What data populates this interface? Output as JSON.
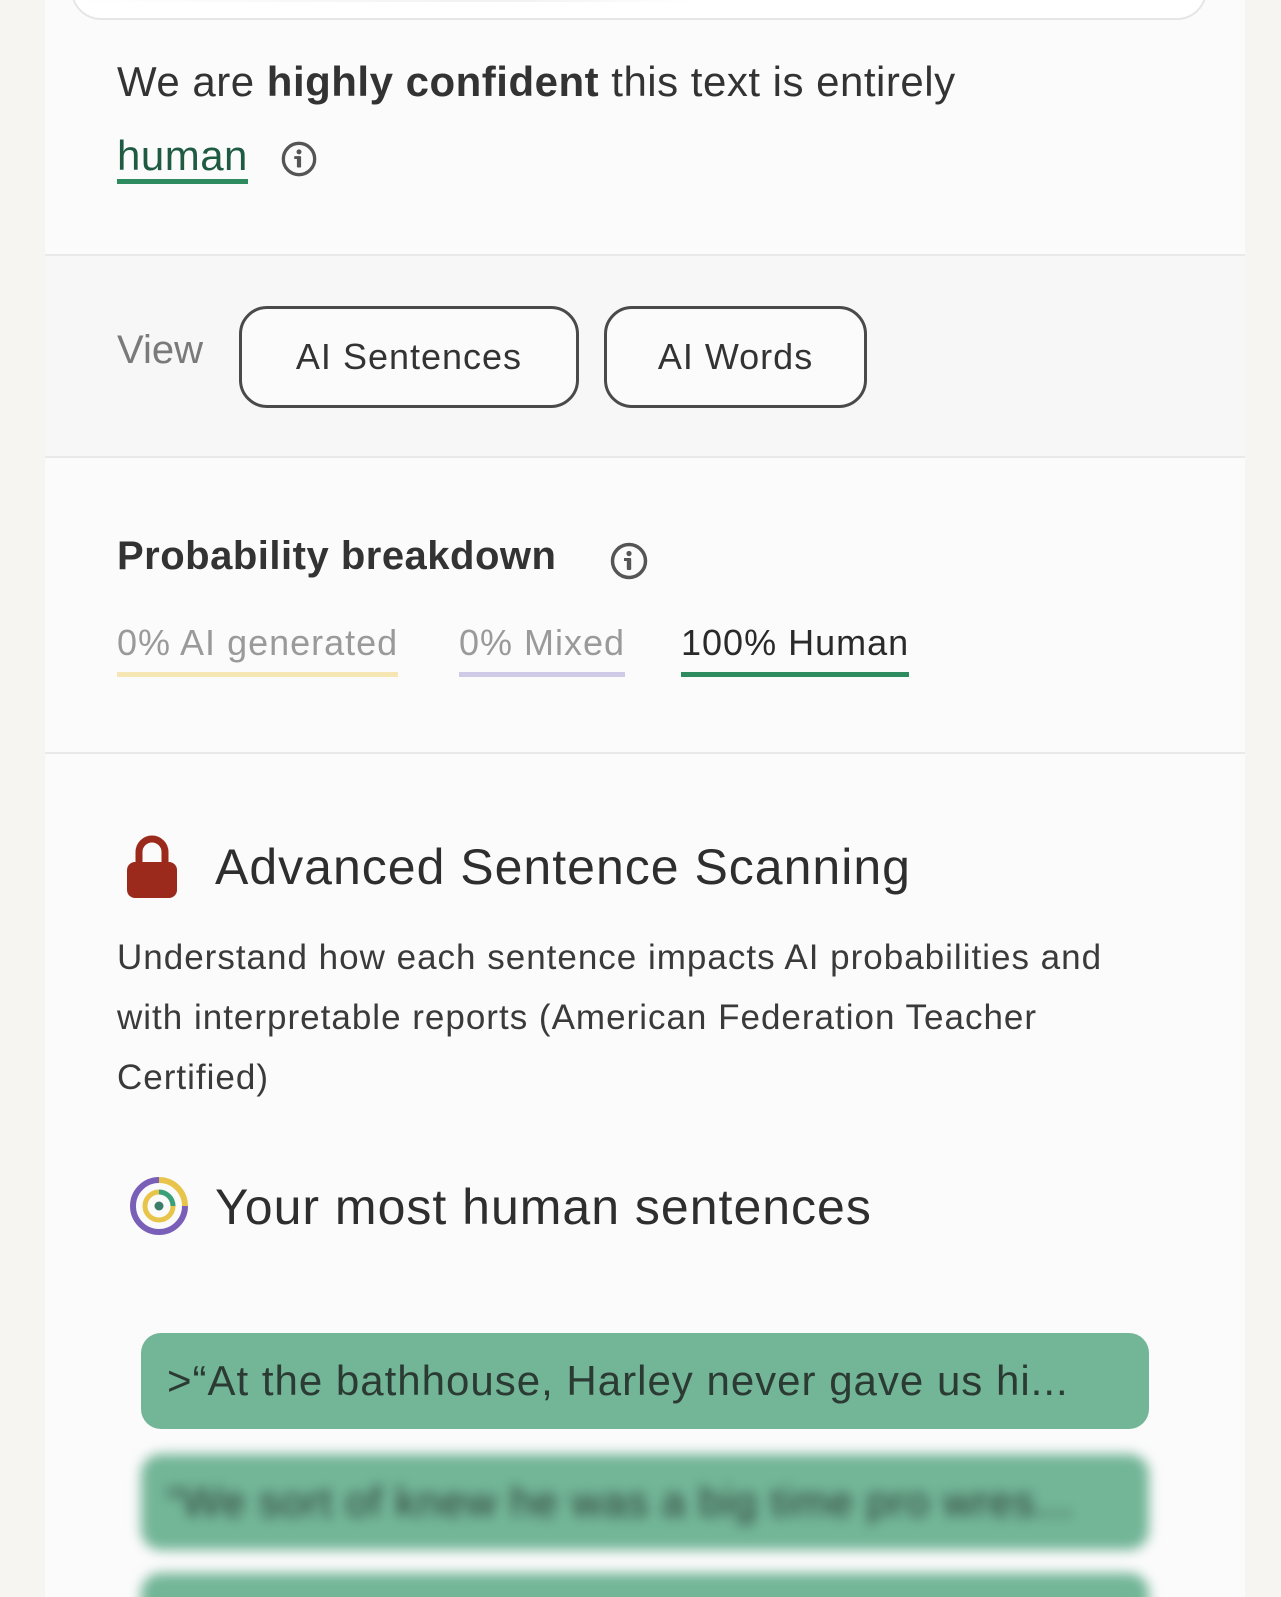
{
  "verdict": {
    "prefix": "We are",
    "emphasis": "highly confident",
    "middle": "this text is entirely",
    "result": "human"
  },
  "view": {
    "label": "View",
    "buttons": [
      "AI Sentences",
      "AI Words"
    ]
  },
  "probability": {
    "title": "Probability breakdown",
    "ai": "0% AI generated",
    "mixed": "0% Mixed",
    "human": "100% Human"
  },
  "advanced": {
    "title": "Advanced Sentence Scanning",
    "description": "Understand how each sentence impacts AI probabilities and with interpretable reports (American Federation Teacher Certified)"
  },
  "most_human": {
    "title": "Your most human sentences",
    "sentences": [
      ">“At the bathhouse, Harley never gave us hi...",
      "“We sort of knew he was a big time pro wres...",
      ""
    ]
  },
  "colors": {
    "human_accent": "#2e8a5f",
    "ai_underline": "#f5e6b3",
    "mixed_underline": "#cfcbe6",
    "sentence_bg": "#72b597",
    "lock": "#9c2a1c"
  },
  "icons": [
    "info-icon",
    "lock-icon",
    "target-icon"
  ]
}
